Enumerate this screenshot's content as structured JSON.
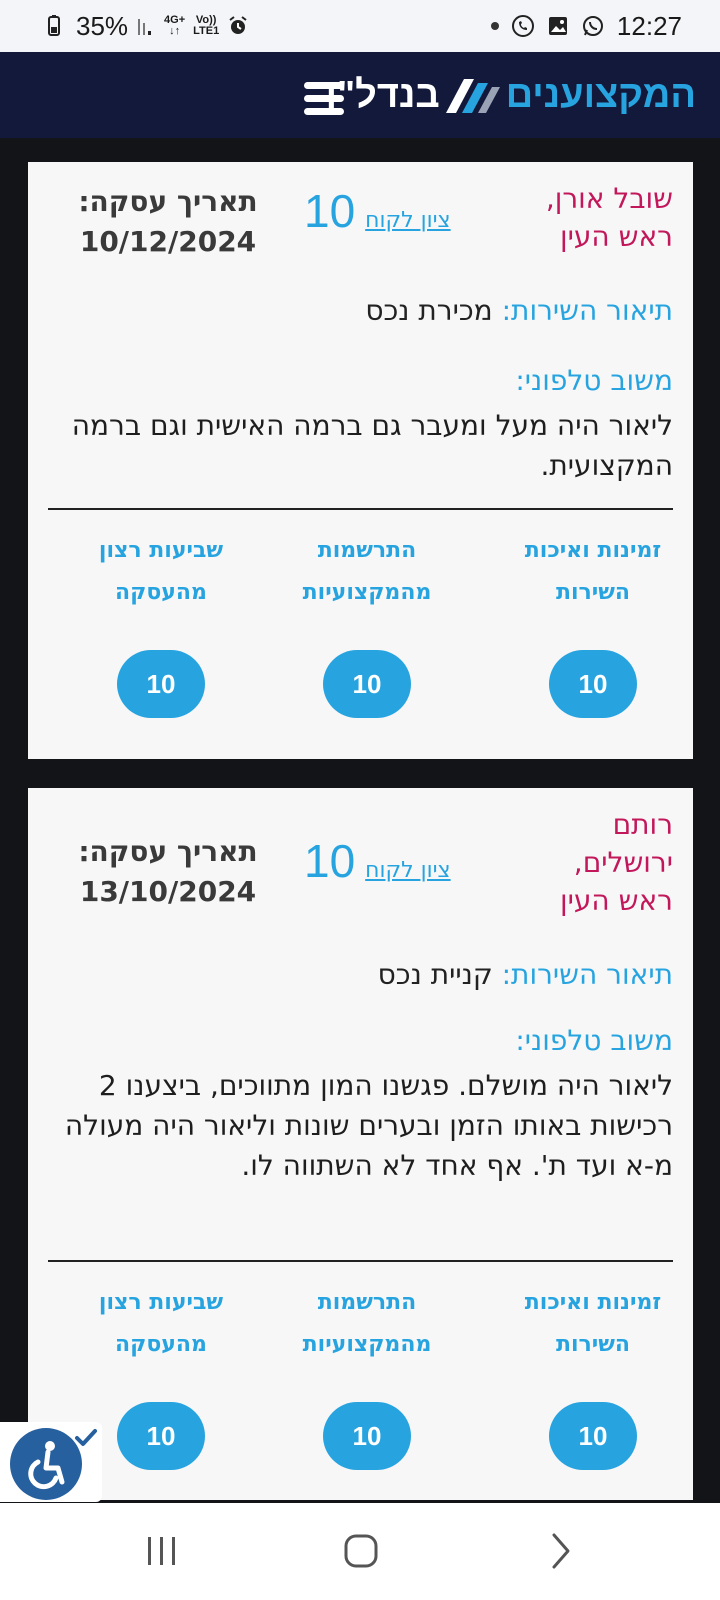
{
  "status_bar": {
    "battery": "35%",
    "network_top": "4G+",
    "network_volte_top": "Vo))",
    "network_volte_bottom": "LTE1",
    "time": "12:27"
  },
  "header": {
    "logo_part1": "המקצוענים",
    "logo_part2": "בנדל\"ן"
  },
  "reviews": [
    {
      "name_lines": [
        "שובל אורן,",
        "ראש העין"
      ],
      "rating_label": "ציון לקוח",
      "rating_value": "10",
      "date_label": "תאריך עסקה:",
      "date_value": "10/12/2024",
      "service_label": "תיאור השירות:",
      "service_value": "מכירת נכס",
      "feedback_label": "משוב טלפוני:",
      "feedback_text": "ליאור היה מעל ומעבר גם ברמה האישית וגם ברמה המקצועית.",
      "scores": [
        {
          "title": "זמינות ואיכות השירות",
          "value": "10"
        },
        {
          "title": "התרשמות מהמקצועיות",
          "value": "10"
        },
        {
          "title": "שביעות רצון מהעסקה",
          "value": "10"
        }
      ]
    },
    {
      "name_lines": [
        "רותם",
        "ירושלים,",
        "ראש העין"
      ],
      "rating_label": "ציון לקוח",
      "rating_value": "10",
      "date_label": "תאריך עסקה:",
      "date_value": "13/10/2024",
      "service_label": "תיאור השירות:",
      "service_value": "קניית נכס",
      "feedback_label": "משוב טלפוני:",
      "feedback_text": "ליאור היה מושלם. פגשנו המון מתווכים, ביצענו 2 רכישות באותו הזמן ובערים שונות וליאור היה מעולה מ-א ועד ת'. אף אחד לא השתווה לו.",
      "scores": [
        {
          "title": "זמינות ואיכות השירות",
          "value": "10"
        },
        {
          "title": "התרשמות מהמקצועיות",
          "value": "10"
        },
        {
          "title": "שביעות רצון מהעסקה",
          "value": "10"
        }
      ]
    }
  ],
  "colors": {
    "accent": "#27a4e0",
    "name": "#c2185b",
    "header_bg": "#13193a",
    "page_bg": "#131417",
    "card_bg": "#f7f7f7",
    "a11y_bg": "#27609e"
  },
  "icons": {
    "menu": "hamburger-menu-icon",
    "accessibility": "accessibility-icon",
    "nav_recent": "recent-apps-icon",
    "nav_home": "home-icon",
    "nav_back": "back-icon"
  }
}
